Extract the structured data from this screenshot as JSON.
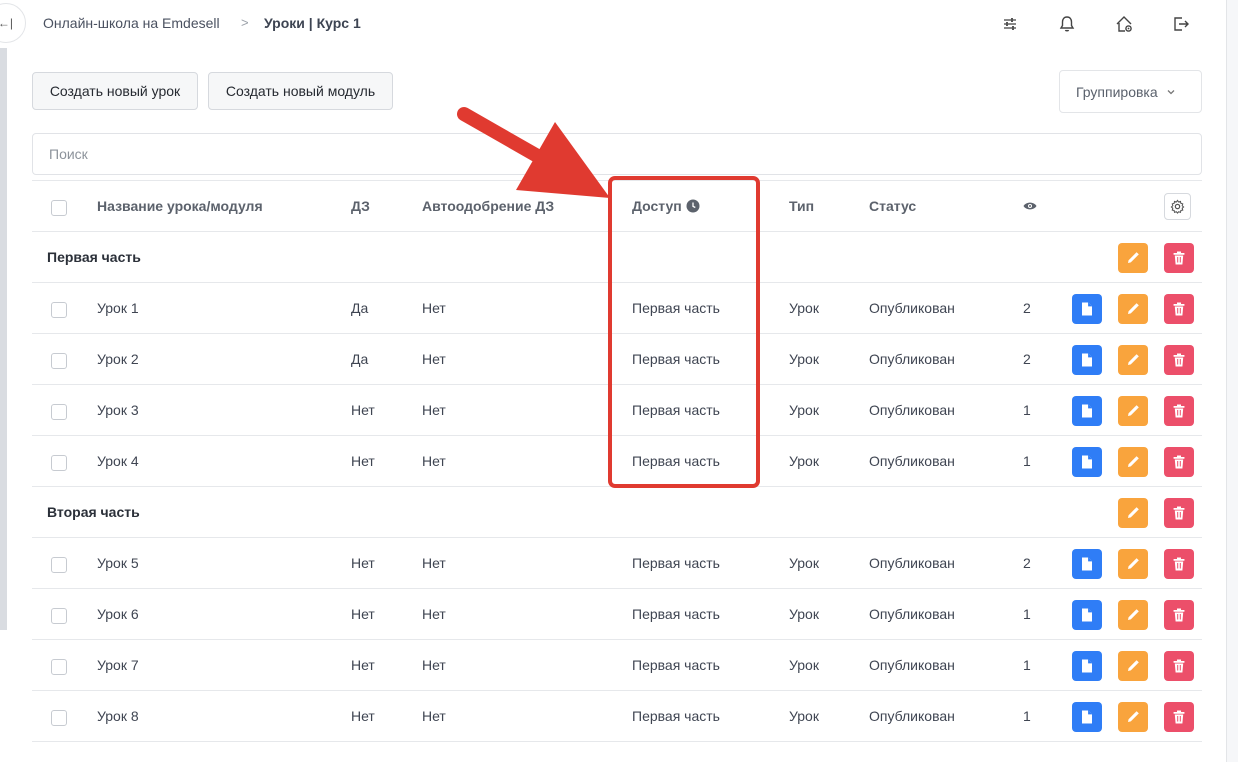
{
  "header": {
    "school": "Онлайн-школа на Emdesell",
    "separator": ">",
    "current": "Уроки | Курс 1",
    "collapse_label": "←|",
    "icons": [
      "sliders-icon",
      "bell-icon",
      "home-settings-icon",
      "logout-icon"
    ]
  },
  "toolbar": {
    "create_lesson": "Создать новый урок",
    "create_module": "Создать новый модуль",
    "grouping": "Группировка"
  },
  "search": {
    "placeholder": "Поиск"
  },
  "table": {
    "columns": {
      "name": "Название урока/модуля",
      "hw": "ДЗ",
      "auto": "Автоодобрение ДЗ",
      "access": "Доступ",
      "type": "Тип",
      "status": "Статус"
    },
    "groups": [
      {
        "title": "Первая часть",
        "rows": [
          {
            "name": "Урок 1",
            "hw": "Да",
            "auto": "Нет",
            "access": "Первая часть",
            "type": "Урок",
            "status": "Опубликован",
            "views": "2"
          },
          {
            "name": "Урок 2",
            "hw": "Да",
            "auto": "Нет",
            "access": "Первая часть",
            "type": "Урок",
            "status": "Опубликован",
            "views": "2"
          },
          {
            "name": "Урок 3",
            "hw": "Нет",
            "auto": "Нет",
            "access": "Первая часть",
            "type": "Урок",
            "status": "Опубликован",
            "views": "1"
          },
          {
            "name": "Урок 4",
            "hw": "Нет",
            "auto": "Нет",
            "access": "Первая часть",
            "type": "Урок",
            "status": "Опубликован",
            "views": "1"
          }
        ]
      },
      {
        "title": "Вторая часть",
        "rows": [
          {
            "name": "Урок 5",
            "hw": "Нет",
            "auto": "Нет",
            "access": "Первая часть",
            "type": "Урок",
            "status": "Опубликован",
            "views": "2"
          },
          {
            "name": "Урок 6",
            "hw": "Нет",
            "auto": "Нет",
            "access": "Первая часть",
            "type": "Урок",
            "status": "Опубликован",
            "views": "1"
          },
          {
            "name": "Урок 7",
            "hw": "Нет",
            "auto": "Нет",
            "access": "Первая часть",
            "type": "Урок",
            "status": "Опубликован",
            "views": "1"
          },
          {
            "name": "Урок 8",
            "hw": "Нет",
            "auto": "Нет",
            "access": "Первая часть",
            "type": "Урок",
            "status": "Опубликован",
            "views": "1"
          }
        ]
      }
    ]
  },
  "colors": {
    "view_button": "#2f7df6",
    "edit_button": "#f9a43d",
    "delete_button": "#ec4f6a",
    "annotation": "#e03a30"
  }
}
